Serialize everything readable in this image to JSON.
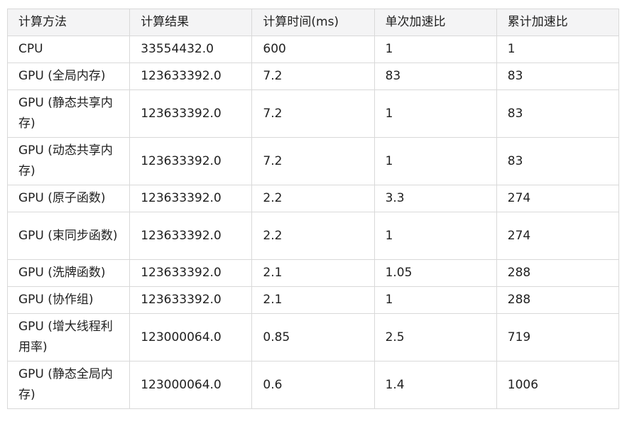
{
  "table": {
    "headers": [
      "计算方法",
      "计算结果",
      "计算时间(ms)",
      "单次加速比",
      "累计加速比"
    ],
    "rows": [
      {
        "method": "CPU",
        "result": "33554432.0",
        "time": "600",
        "single": "1",
        "cumulative": "1"
      },
      {
        "method": "GPU (全局内存)",
        "result": "123633392.0",
        "time": "7.2",
        "single": "83",
        "cumulative": "83"
      },
      {
        "method": "GPU (静态共享内存)",
        "result": "123633392.0",
        "time": "7.2",
        "single": "1",
        "cumulative": "83"
      },
      {
        "method": "GPU (动态共享内存)",
        "result": "123633392.0",
        "time": "7.2",
        "single": "1",
        "cumulative": "83"
      },
      {
        "method": "GPU (原子函数)",
        "result": "123633392.0",
        "time": "2.2",
        "single": "3.3",
        "cumulative": "274"
      },
      {
        "method": "GPU (束同步函数)",
        "result": "123633392.0",
        "time": "2.2",
        "single": "1",
        "cumulative": "274"
      },
      {
        "method": "GPU (洗牌函数)",
        "result": "123633392.0",
        "time": "2.1",
        "single": "1.05",
        "cumulative": "288"
      },
      {
        "method": "GPU (协作组)",
        "result": "123633392.0",
        "time": "2.1",
        "single": "1",
        "cumulative": "288"
      },
      {
        "method": "GPU (增大线程利用率)",
        "result": "123000064.0",
        "time": "0.85",
        "single": "2.5",
        "cumulative": "719"
      },
      {
        "method": "GPU (静态全局内存)",
        "result": "123000064.0",
        "time": "0.6",
        "single": "1.4",
        "cumulative": "1006"
      }
    ]
  }
}
